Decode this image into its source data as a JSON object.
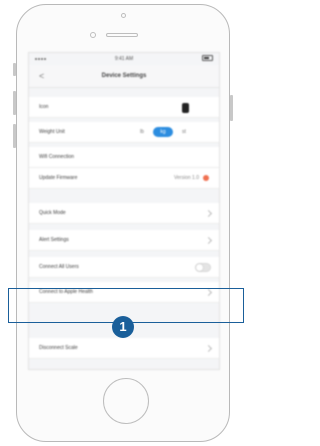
{
  "status_bar": {
    "time": "9:41 AM",
    "battery": "100%"
  },
  "nav": {
    "back": "<",
    "title": "Device Settings"
  },
  "rows": [
    {
      "label": "Icon"
    },
    {
      "label": "Weight Unit",
      "options": [
        "lb",
        "kg",
        "st"
      ],
      "selected": "kg"
    },
    {
      "label": "Wifi Connection"
    },
    {
      "label": "Update Firmware",
      "value": "Version 1.0"
    },
    {
      "label": "Quick Mode"
    },
    {
      "label": "Alert Settings"
    },
    {
      "label": "Connect All Users"
    },
    {
      "label": "Connect to Apple Health"
    },
    {
      "label": "Disconnect Scale"
    }
  ],
  "callout": {
    "number": "1",
    "color": "#1a5f9a"
  }
}
